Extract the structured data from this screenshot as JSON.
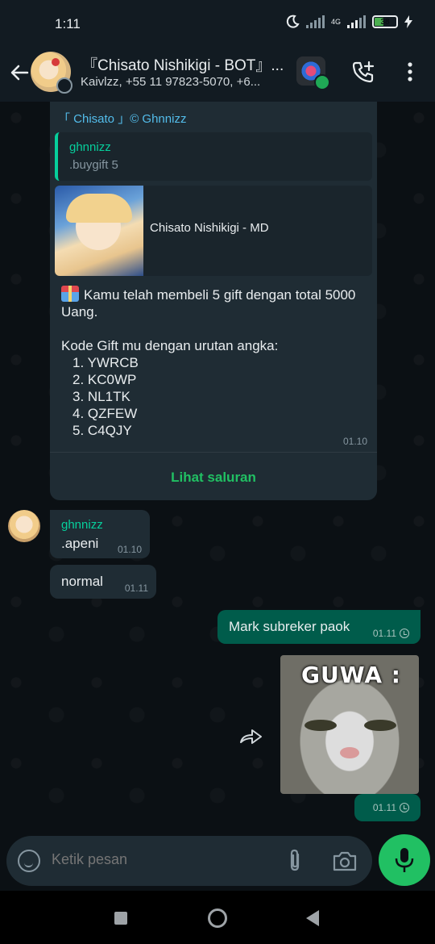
{
  "status_bar": {
    "time": "1:11",
    "network": "4G",
    "battery": "38"
  },
  "header": {
    "title": "『Chisato Nishikigi - BOT』...",
    "subtitle": "Kaivlzz, +55 11 97823-5070, +6..."
  },
  "channel_message": {
    "sender": "「 Chisato 」© Ghnnizz",
    "quote": {
      "name": "ghnnizz",
      "text": ".buygift 5"
    },
    "preview_title": "Chisato Nishikigi - MD",
    "line1": "Kamu telah membeli 5 gift dengan total 5000 Uang.",
    "line2": "Kode Gift mu dengan urutan angka:",
    "codes": [
      "1. YWRCB",
      "2. KC0WP",
      "3. NL1TK",
      "4. QZFEW",
      "5. C4QJY"
    ],
    "time": "01.10",
    "action": "Lihat saluran"
  },
  "incoming": [
    {
      "name": "ghnnizz",
      "text": ".apeni",
      "time": "01.10"
    },
    {
      "text": "normal",
      "time": "01.11"
    }
  ],
  "outgoing": [
    {
      "text": "Mark subreker paok",
      "time": "01.11"
    },
    {
      "sticker_text": "GUWA :",
      "time": "01.11"
    }
  ],
  "composer": {
    "placeholder": "Ketik pesan"
  },
  "colors": {
    "background": "#0b1014",
    "incoming_bubble": "#1f2c34",
    "outgoing_bubble": "#005c4b",
    "accent_green": "#21c063",
    "sender_teal": "#06cf9c",
    "link_blue": "#53bdeb"
  },
  "icons": [
    "back-arrow-icon",
    "add-call-icon",
    "more-vert-icon",
    "emoji-icon",
    "attach-icon",
    "camera-icon",
    "mic-icon",
    "forward-icon",
    "pending-clock-icon",
    "moon-icon",
    "signal-icon",
    "battery-icon",
    "gift-icon"
  ]
}
